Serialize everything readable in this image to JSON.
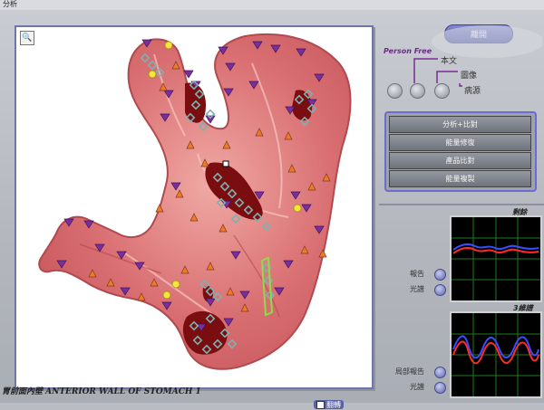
{
  "window": {
    "title": "分析"
  },
  "toolbar": {
    "close_label": "離開",
    "zoom_icon": "magnifier-icon"
  },
  "options": {
    "brand": "Person Free",
    "items": [
      {
        "label": "本文"
      },
      {
        "label": "圖像"
      },
      {
        "label": "病源"
      }
    ]
  },
  "functions": [
    {
      "label": "分析+比對"
    },
    {
      "label": "能量修復"
    },
    {
      "label": "產品比對"
    },
    {
      "label": "能量複製"
    }
  ],
  "image": {
    "caption": "胃前面內壁 ANTERIOR WALL OF STOMACH 1",
    "rotate_label": "翻轉"
  },
  "graphs": [
    {
      "title": "剩餘",
      "buttons": [
        {
          "label": "報告"
        },
        {
          "label": "光譜"
        }
      ]
    },
    {
      "title": "3維譜",
      "buttons": [
        {
          "label": "局部報告"
        },
        {
          "label": "光譜"
        }
      ]
    }
  ],
  "colors": {
    "accent": "#5a62a4",
    "graph_red": "#ff2a2a",
    "graph_blue": "#3a4dff",
    "graph_grid": "#1f7a1f"
  }
}
